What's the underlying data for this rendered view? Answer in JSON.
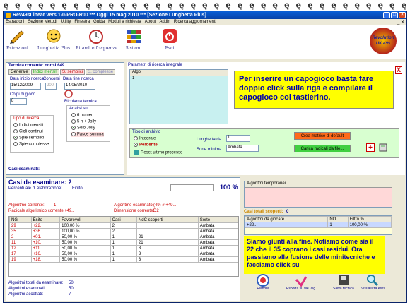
{
  "window": {
    "title": "Rev49sLinear vers.1-0-PRO-R00  ***  Oggi 15 mag 2010  ***  [Sezione Lunghetta Plus]"
  },
  "menu": [
    "Estrazioni",
    "Sezione Metodi",
    "Utility",
    "Finestra",
    "Guida",
    "Moduli a richiesta",
    "About",
    "Addin",
    "Ricerca aggiornamenti"
  ],
  "menu_right": "_ ✕",
  "toolbar": [
    {
      "label": "Estrazioni",
      "icon": "pencil-icon"
    },
    {
      "label": "Lunghetta Plus",
      "icon": "bonhomme-icon"
    },
    {
      "label": "Ritardi e frequenze",
      "icon": "alarm-clock-icon"
    },
    {
      "label": "Sistemi",
      "icon": "grid-icon"
    },
    {
      "label": "Esci",
      "icon": "power-icon"
    }
  ],
  "logo_text": "Revolution UK 49s",
  "technique": {
    "title": "Tecnica corrente: nnnsL649",
    "tabs": [
      "Generale",
      "Indici mensili",
      "S. semplici",
      "S. complesse"
    ],
    "date_start_label": "Data inizio ricerca",
    "date_start": "15/12/2009",
    "concorsi_label": "Concorsi",
    "concorsi": "200",
    "date_end_label": "Data fine ricerca",
    "date_end": "14/05/2010",
    "colpi_label": "Colpi di gioco",
    "colpi": "8",
    "richiama_label": "Richiama tecnica",
    "analisi_label": "Analisi su...",
    "analisi_options": [
      "6 numeri",
      "5 n + Jolly",
      "Solo Jolly",
      "Fasce somma"
    ],
    "tipo_label": "Tipo di ricerca",
    "tipo_options": [
      "Indici mensili",
      "Cicli continui",
      "Spie semplici",
      "Spie complesse"
    ],
    "casi_label": "Casi esaminati:"
  },
  "params": {
    "title": "Parametri di ricerca integrale",
    "algo_header": "Algo",
    "algo_row": "1",
    "close": "X",
    "tipo_archivio_label": "Tipo di archivio",
    "archivio_options": [
      "Integrale",
      "Perdente"
    ],
    "reset_label": "Reset ultimo processo",
    "lunghetta_label": "Lunghetta da",
    "lunghetta_value": "1",
    "sorte_label": "Sorte minima",
    "sorte_value": "Ambata",
    "btn_matrice": "Crea matrice di default",
    "btn_carica": "Carica radicali da file..."
  },
  "note1": "Per inserire un capogioco basta fare doppio click sulla riga e compilare il capogioco col tastierino.",
  "cases": {
    "title": "Casi da esaminare: 2",
    "perc_label": "Percentuale di elaborazione:",
    "perc_value": "Finito!",
    "progress": "100 %",
    "algo_corrente_label": "Algoritmo corrente:",
    "algo_corrente": "1",
    "algo_esaminato_label": "Algoritmo esaminato",
    "algo_esaminato": "(49) # +49...",
    "radicale_label": "Radicale algoritmico corrente:",
    "radicale": "+49..",
    "dimensione_label": "Dimensione corrente:",
    "dimensione": "D2",
    "headers": [
      "NG",
      "Esito",
      "Favorevoli",
      "Casi",
      "NdC scoperti",
      "Sorte"
    ],
    "rows": [
      [
        "29",
        "+22..",
        "100,00 %",
        "2",
        "",
        "Ambata"
      ],
      [
        "35",
        "+36..",
        "100,00 %",
        "2",
        "",
        "Ambata"
      ],
      [
        "2",
        "+01..",
        "50,00 %",
        "1",
        "21",
        "Ambata"
      ],
      [
        "11",
        "+10..",
        "50,00 %",
        "1",
        "21",
        "Ambata"
      ],
      [
        "12",
        "+11..",
        "50,00 %",
        "1",
        "3",
        "Ambata"
      ],
      [
        "17",
        "+16..",
        "50,00 %",
        "1",
        "3",
        "Ambata"
      ],
      [
        "19",
        "+18..",
        "50,00 %",
        "1",
        "3",
        "Ambata"
      ]
    ],
    "tot_label": "Algoritmi totali da esaminare:",
    "tot": "50",
    "esaminati_label": "Algoritmi esaminati:",
    "esaminati": "50",
    "accettati_label": "Algoritmi accettati:",
    "accettati": "7"
  },
  "temp": {
    "header": "Algoritmi temporanei"
  },
  "scoperti": {
    "title": "Casi totali scoperti:",
    "value": "0",
    "headers": [
      "Algoritmi da giocare",
      "NO",
      "Filtro %"
    ],
    "row": [
      "+22..",
      "1",
      "100,00 %"
    ]
  },
  "note2": "Siamo giunti alla fine. Notiamo come sia il 22 che il 35 coprano i casi residui. Ora passiamo alla fusione delle minitecniche e facciamo click su",
  "actions": [
    "Elabora",
    "Esporta su file .alg",
    "Salva tecnica",
    "Visualizza esiti"
  ],
  "colors": {
    "title": "#0842a8",
    "note_bg": "#ffff00",
    "scoperti": "#ffcc00",
    "panel_border": "#7f9db9"
  }
}
